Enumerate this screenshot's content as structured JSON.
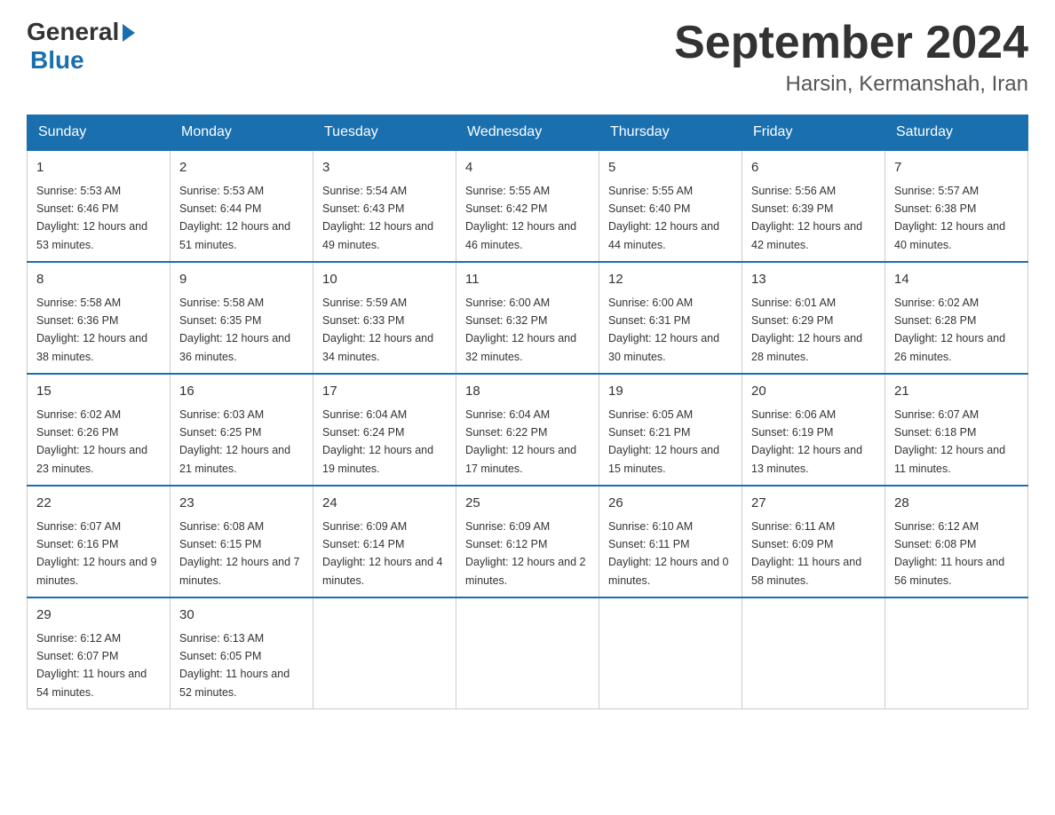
{
  "header": {
    "logo_general": "General",
    "logo_blue": "Blue",
    "month_title": "September 2024",
    "location": "Harsin, Kermanshah, Iran"
  },
  "calendar": {
    "days_of_week": [
      "Sunday",
      "Monday",
      "Tuesday",
      "Wednesday",
      "Thursday",
      "Friday",
      "Saturday"
    ],
    "weeks": [
      [
        {
          "day": "1",
          "sunrise": "5:53 AM",
          "sunset": "6:46 PM",
          "daylight": "12 hours and 53 minutes."
        },
        {
          "day": "2",
          "sunrise": "5:53 AM",
          "sunset": "6:44 PM",
          "daylight": "12 hours and 51 minutes."
        },
        {
          "day": "3",
          "sunrise": "5:54 AM",
          "sunset": "6:43 PM",
          "daylight": "12 hours and 49 minutes."
        },
        {
          "day": "4",
          "sunrise": "5:55 AM",
          "sunset": "6:42 PM",
          "daylight": "12 hours and 46 minutes."
        },
        {
          "day": "5",
          "sunrise": "5:55 AM",
          "sunset": "6:40 PM",
          "daylight": "12 hours and 44 minutes."
        },
        {
          "day": "6",
          "sunrise": "5:56 AM",
          "sunset": "6:39 PM",
          "daylight": "12 hours and 42 minutes."
        },
        {
          "day": "7",
          "sunrise": "5:57 AM",
          "sunset": "6:38 PM",
          "daylight": "12 hours and 40 minutes."
        }
      ],
      [
        {
          "day": "8",
          "sunrise": "5:58 AM",
          "sunset": "6:36 PM",
          "daylight": "12 hours and 38 minutes."
        },
        {
          "day": "9",
          "sunrise": "5:58 AM",
          "sunset": "6:35 PM",
          "daylight": "12 hours and 36 minutes."
        },
        {
          "day": "10",
          "sunrise": "5:59 AM",
          "sunset": "6:33 PM",
          "daylight": "12 hours and 34 minutes."
        },
        {
          "day": "11",
          "sunrise": "6:00 AM",
          "sunset": "6:32 PM",
          "daylight": "12 hours and 32 minutes."
        },
        {
          "day": "12",
          "sunrise": "6:00 AM",
          "sunset": "6:31 PM",
          "daylight": "12 hours and 30 minutes."
        },
        {
          "day": "13",
          "sunrise": "6:01 AM",
          "sunset": "6:29 PM",
          "daylight": "12 hours and 28 minutes."
        },
        {
          "day": "14",
          "sunrise": "6:02 AM",
          "sunset": "6:28 PM",
          "daylight": "12 hours and 26 minutes."
        }
      ],
      [
        {
          "day": "15",
          "sunrise": "6:02 AM",
          "sunset": "6:26 PM",
          "daylight": "12 hours and 23 minutes."
        },
        {
          "day": "16",
          "sunrise": "6:03 AM",
          "sunset": "6:25 PM",
          "daylight": "12 hours and 21 minutes."
        },
        {
          "day": "17",
          "sunrise": "6:04 AM",
          "sunset": "6:24 PM",
          "daylight": "12 hours and 19 minutes."
        },
        {
          "day": "18",
          "sunrise": "6:04 AM",
          "sunset": "6:22 PM",
          "daylight": "12 hours and 17 minutes."
        },
        {
          "day": "19",
          "sunrise": "6:05 AM",
          "sunset": "6:21 PM",
          "daylight": "12 hours and 15 minutes."
        },
        {
          "day": "20",
          "sunrise": "6:06 AM",
          "sunset": "6:19 PM",
          "daylight": "12 hours and 13 minutes."
        },
        {
          "day": "21",
          "sunrise": "6:07 AM",
          "sunset": "6:18 PM",
          "daylight": "12 hours and 11 minutes."
        }
      ],
      [
        {
          "day": "22",
          "sunrise": "6:07 AM",
          "sunset": "6:16 PM",
          "daylight": "12 hours and 9 minutes."
        },
        {
          "day": "23",
          "sunrise": "6:08 AM",
          "sunset": "6:15 PM",
          "daylight": "12 hours and 7 minutes."
        },
        {
          "day": "24",
          "sunrise": "6:09 AM",
          "sunset": "6:14 PM",
          "daylight": "12 hours and 4 minutes."
        },
        {
          "day": "25",
          "sunrise": "6:09 AM",
          "sunset": "6:12 PM",
          "daylight": "12 hours and 2 minutes."
        },
        {
          "day": "26",
          "sunrise": "6:10 AM",
          "sunset": "6:11 PM",
          "daylight": "12 hours and 0 minutes."
        },
        {
          "day": "27",
          "sunrise": "6:11 AM",
          "sunset": "6:09 PM",
          "daylight": "11 hours and 58 minutes."
        },
        {
          "day": "28",
          "sunrise": "6:12 AM",
          "sunset": "6:08 PM",
          "daylight": "11 hours and 56 minutes."
        }
      ],
      [
        {
          "day": "29",
          "sunrise": "6:12 AM",
          "sunset": "6:07 PM",
          "daylight": "11 hours and 54 minutes."
        },
        {
          "day": "30",
          "sunrise": "6:13 AM",
          "sunset": "6:05 PM",
          "daylight": "11 hours and 52 minutes."
        },
        null,
        null,
        null,
        null,
        null
      ]
    ]
  }
}
